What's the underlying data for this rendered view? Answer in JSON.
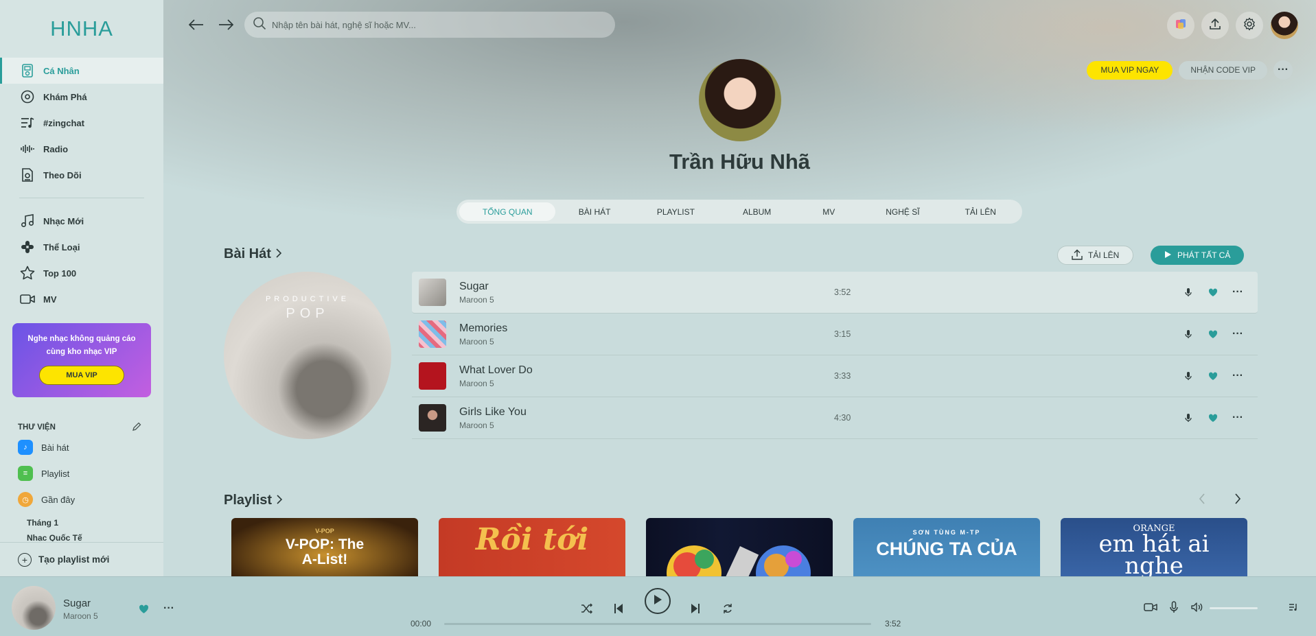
{
  "brand": {
    "logo": "HNHA",
    "accent": "#2a9d9a"
  },
  "sidebar": {
    "nav": [
      {
        "label": "Cá Nhân",
        "icon": "ipod-icon",
        "active": true
      },
      {
        "label": "Khám Phá",
        "icon": "disc-icon"
      },
      {
        "label": "#zingchat",
        "icon": "chart-list-icon"
      },
      {
        "label": "Radio",
        "icon": "radio-wave-icon"
      },
      {
        "label": "Theo Dõi",
        "icon": "news-icon"
      }
    ],
    "nav2": [
      {
        "label": "Nhạc Mới",
        "icon": "music-note-icon"
      },
      {
        "label": "Thể Loại",
        "icon": "category-icon"
      },
      {
        "label": "Top 100",
        "icon": "star-icon"
      },
      {
        "label": "MV",
        "icon": "video-icon"
      }
    ],
    "vip_promo": {
      "text": "Nghe nhạc không quảng cáo cùng kho nhạc VIP",
      "button": "MUA VIP"
    },
    "library": {
      "title": "THƯ VIỆN",
      "items": [
        {
          "label": "Bài hát",
          "icon": "song-library-icon",
          "color": "#1e90ff"
        },
        {
          "label": "Playlist",
          "icon": "playlist-library-icon",
          "color": "#4fbf4f"
        },
        {
          "label": "Gần đây",
          "icon": "clock-icon",
          "color": "#f0a73a"
        }
      ],
      "months": [
        "Tháng 1",
        "Nhạc Quốc Tế"
      ]
    },
    "new_playlist": "Tạo playlist mới"
  },
  "header": {
    "search_placeholder": "Nhập tên bài hát, nghệ sĩ hoặc MV...",
    "buy_vip": "MUA VIP NGAY",
    "vip_code": "NHẬN CODE VIP"
  },
  "profile": {
    "name": "Trần Hữu Nhã"
  },
  "tabs": [
    "TỔNG QUAN",
    "BÀI HÁT",
    "PLAYLIST",
    "ALBUM",
    "MV",
    "NGHỆ SĨ",
    "TẢI LÊN"
  ],
  "songs_section": {
    "title": "Bài Hát",
    "upload": "TẢI LÊN",
    "play_all": "PHÁT TẤT CẢ",
    "cover_line1": "PRODUCTIVE",
    "cover_line2": "POP",
    "songs": [
      {
        "title": "Sugar",
        "artist": "Maroon 5",
        "duration": "3:52"
      },
      {
        "title": "Memories",
        "artist": "Maroon 5",
        "duration": "3:15"
      },
      {
        "title": "What Lover Do",
        "artist": "Maroon 5",
        "duration": "3:33"
      },
      {
        "title": "Girls Like You",
        "artist": "Maroon 5",
        "duration": "4:30"
      }
    ]
  },
  "playlist_section": {
    "title": "Playlist",
    "cards": [
      {
        "label": "V-POP: The A-List!",
        "tag": "V-POP"
      },
      {
        "label": "Rồi tới"
      },
      {
        "label": ""
      },
      {
        "label": "CHÚNG TA CỦA",
        "tag": "SƠN TÙNG M-TP"
      },
      {
        "label": "em hát ai nghe",
        "tag": "ORANGE"
      }
    ]
  },
  "player": {
    "title": "Sugar",
    "artist": "Maroon 5",
    "current": "00:00",
    "total": "3:52",
    "progress": 0
  }
}
